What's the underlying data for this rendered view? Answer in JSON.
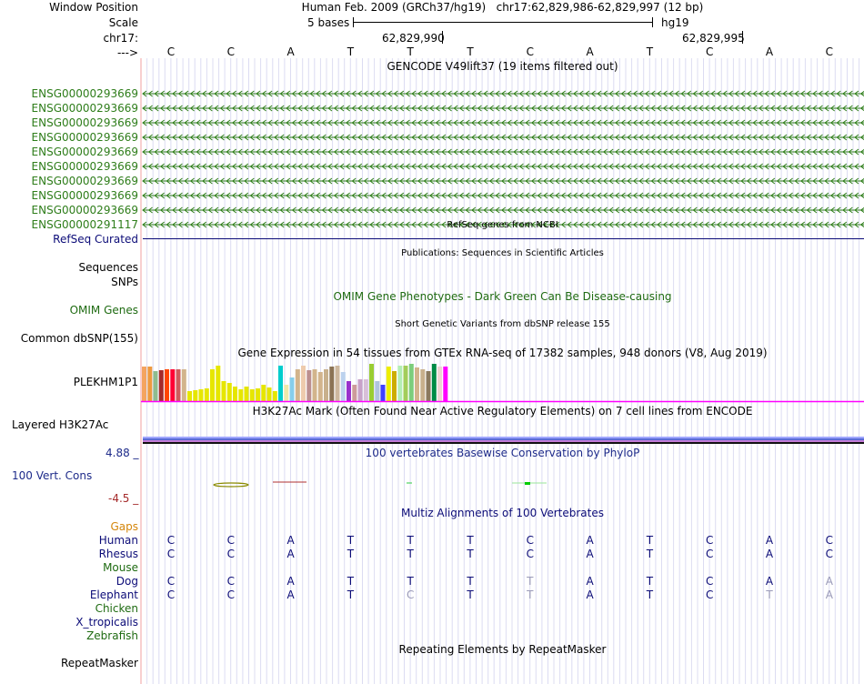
{
  "header": {
    "window_position_label": "Window Position",
    "window_position_text": "Human Feb. 2009 (GRCh37/hg19)   chr17:62,829,986-62,829,997 (12 bp)",
    "scale_label": "Scale",
    "scale_bar_text": "5 bases",
    "assembly": "hg19",
    "chrom_label": "chr17:",
    "coord_1": "62,829,990",
    "coord_2": "62,829,995",
    "strand_arrow": "--->",
    "bases": [
      "C",
      "C",
      "A",
      "T",
      "T",
      "T",
      "C",
      "A",
      "T",
      "C",
      "A",
      "C"
    ]
  },
  "gencode": {
    "title": "GENCODE V49lift37 (19 items filtered out)",
    "color": "#2e7d1a",
    "items": [
      "ENSG00000293669",
      "ENSG00000293669",
      "ENSG00000293669",
      "ENSG00000293669",
      "ENSG00000293669",
      "ENSG00000293669",
      "ENSG00000293669",
      "ENSG00000293669",
      "ENSG00000293669",
      "ENSG00000291117"
    ]
  },
  "refseq": {
    "title": "RefSeq genes from NCBI",
    "label": "RefSeq Curated",
    "color": "#0c0c78"
  },
  "publications": {
    "title": "Publications: Sequences in Scientific Articles",
    "label_1": "Sequences",
    "label_2": "SNPs"
  },
  "omim": {
    "title": "OMIM Gene Phenotypes - Dark Green Can Be Disease-causing",
    "label": "OMIM Genes",
    "color": "#1f6b12"
  },
  "dbsnp": {
    "title": "Short Genetic Variants from dbSNP release 155",
    "label": "Common dbSNP(155)"
  },
  "gtex": {
    "title": "Gene Expression in 54 tissues from GTEx RNA-seq of 17382 samples, 948 donors (V8, Aug 2019)",
    "label": "PLEKHM1P1",
    "bars": [
      {
        "color": "#f4a460",
        "level": 0.93
      },
      {
        "color": "#ee9a40",
        "level": 0.93
      },
      {
        "color": "#8fbc8f",
        "level": 0.8
      },
      {
        "color": "#a52a2a",
        "level": 0.83
      },
      {
        "color": "#ff4500",
        "level": 0.85
      },
      {
        "color": "#ff0033",
        "level": 0.85
      },
      {
        "color": "#cd5c5c",
        "level": 0.85
      },
      {
        "color": "#d2b48c",
        "level": 0.85
      },
      {
        "color": "#e6e600",
        "level": 0.28
      },
      {
        "color": "#e6e600",
        "level": 0.3
      },
      {
        "color": "#e6e600",
        "level": 0.33
      },
      {
        "color": "#e6e600",
        "level": 0.36
      },
      {
        "color": "#e6e600",
        "level": 0.85
      },
      {
        "color": "#e6e600",
        "level": 0.95
      },
      {
        "color": "#e6e600",
        "level": 0.55
      },
      {
        "color": "#e6e600",
        "level": 0.5
      },
      {
        "color": "#e6e600",
        "level": 0.4
      },
      {
        "color": "#e6e600",
        "level": 0.33
      },
      {
        "color": "#e6e600",
        "level": 0.4
      },
      {
        "color": "#e6e600",
        "level": 0.33
      },
      {
        "color": "#e6e600",
        "level": 0.35
      },
      {
        "color": "#e6e600",
        "level": 0.45
      },
      {
        "color": "#e6e600",
        "level": 0.38
      },
      {
        "color": "#e6e600",
        "level": 0.28
      },
      {
        "color": "#00cdcd",
        "level": 0.95
      },
      {
        "color": "#eee8aa",
        "level": 0.45
      },
      {
        "color": "#87ceeb",
        "level": 0.65
      },
      {
        "color": "#d2b48c",
        "level": 0.85
      },
      {
        "color": "#eecbad",
        "level": 0.95
      },
      {
        "color": "#bc8f8f",
        "level": 0.83
      },
      {
        "color": "#d2b48c",
        "level": 0.85
      },
      {
        "color": "#d2b48c",
        "level": 0.78
      },
      {
        "color": "#c8b08c",
        "level": 0.85
      },
      {
        "color": "#8b7355",
        "level": 0.93
      },
      {
        "color": "#cdb79e",
        "level": 0.95
      },
      {
        "color": "#bcd2ee",
        "level": 0.78
      },
      {
        "color": "#9932cc",
        "level": 0.55
      },
      {
        "color": "#cd9b9b",
        "level": 0.45
      },
      {
        "color": "#c8a2c8",
        "level": 0.6
      },
      {
        "color": "#d8bfd8",
        "level": 0.6
      },
      {
        "color": "#9acd32",
        "level": 1.0
      },
      {
        "color": "#b0c4de",
        "level": 0.55
      },
      {
        "color": "#4040ff",
        "level": 0.45
      },
      {
        "color": "#eeee00",
        "level": 0.93
      },
      {
        "color": "#cdad00",
        "level": 0.8
      },
      {
        "color": "#b4eeb4",
        "level": 0.95
      },
      {
        "color": "#a2cd5a",
        "level": 0.95
      },
      {
        "color": "#7ccd7c",
        "level": 1.0
      },
      {
        "color": "#d2b48c",
        "level": 0.9
      },
      {
        "color": "#c8b08c",
        "level": 0.85
      },
      {
        "color": "#8b795e",
        "level": 0.8
      },
      {
        "color": "#008b45",
        "level": 1.0
      },
      {
        "color": "#eed5d2",
        "level": 0.93
      },
      {
        "color": "#ff00ff",
        "level": 0.93
      }
    ]
  },
  "h3k27ac": {
    "title": "H3K27Ac Mark (Often Found Near Active Regulatory Elements) on 7 cell lines from ENCODE",
    "label": "Layered H3K27Ac"
  },
  "phylop": {
    "title": "100 vertebrates Basewise Conservation by PhyloP",
    "label": "100 Vert. Cons",
    "max_label": "4.88 _",
    "min_label": "-4.5 _",
    "title_color": "#1e2b8a",
    "min_color": "#a52a2a"
  },
  "multiz": {
    "title": "Multiz Alignments of 100 Vertebrates",
    "gaps_label": "Gaps",
    "gaps_color": "#d4860b",
    "species": [
      {
        "name": "Human",
        "color": "#0c0c78",
        "bases": [
          "C",
          "C",
          "A",
          "T",
          "T",
          "T",
          "C",
          "A",
          "T",
          "C",
          "A",
          "C"
        ],
        "faded": []
      },
      {
        "name": "Rhesus",
        "color": "#0c0c78",
        "bases": [
          "C",
          "C",
          "A",
          "T",
          "T",
          "T",
          "C",
          "A",
          "T",
          "C",
          "A",
          "C"
        ],
        "faded": []
      },
      {
        "name": "Mouse",
        "color": "#1f6b12",
        "bases": [],
        "faded": []
      },
      {
        "name": "Dog",
        "color": "#0c0c78",
        "bases": [
          "C",
          "C",
          "A",
          "T",
          "T",
          "T",
          "T",
          "A",
          "T",
          "C",
          "A",
          "A"
        ],
        "faded": [
          6,
          11
        ]
      },
      {
        "name": "Elephant",
        "color": "#0c0c78",
        "bases": [
          "C",
          "C",
          "A",
          "T",
          "C",
          "T",
          "T",
          "A",
          "T",
          "C",
          "T",
          "A"
        ],
        "faded": [
          4,
          6,
          10,
          11
        ]
      },
      {
        "name": "Chicken",
        "color": "#1f6b12",
        "bases": [],
        "faded": []
      },
      {
        "name": "X_tropicalis",
        "color": "#0c0c78",
        "bases": [],
        "faded": []
      },
      {
        "name": "Zebrafish",
        "color": "#1f6b12",
        "bases": [],
        "faded": []
      }
    ]
  },
  "repeatmasker": {
    "title": "Repeating Elements by RepeatMasker",
    "label": "RepeatMasker"
  }
}
